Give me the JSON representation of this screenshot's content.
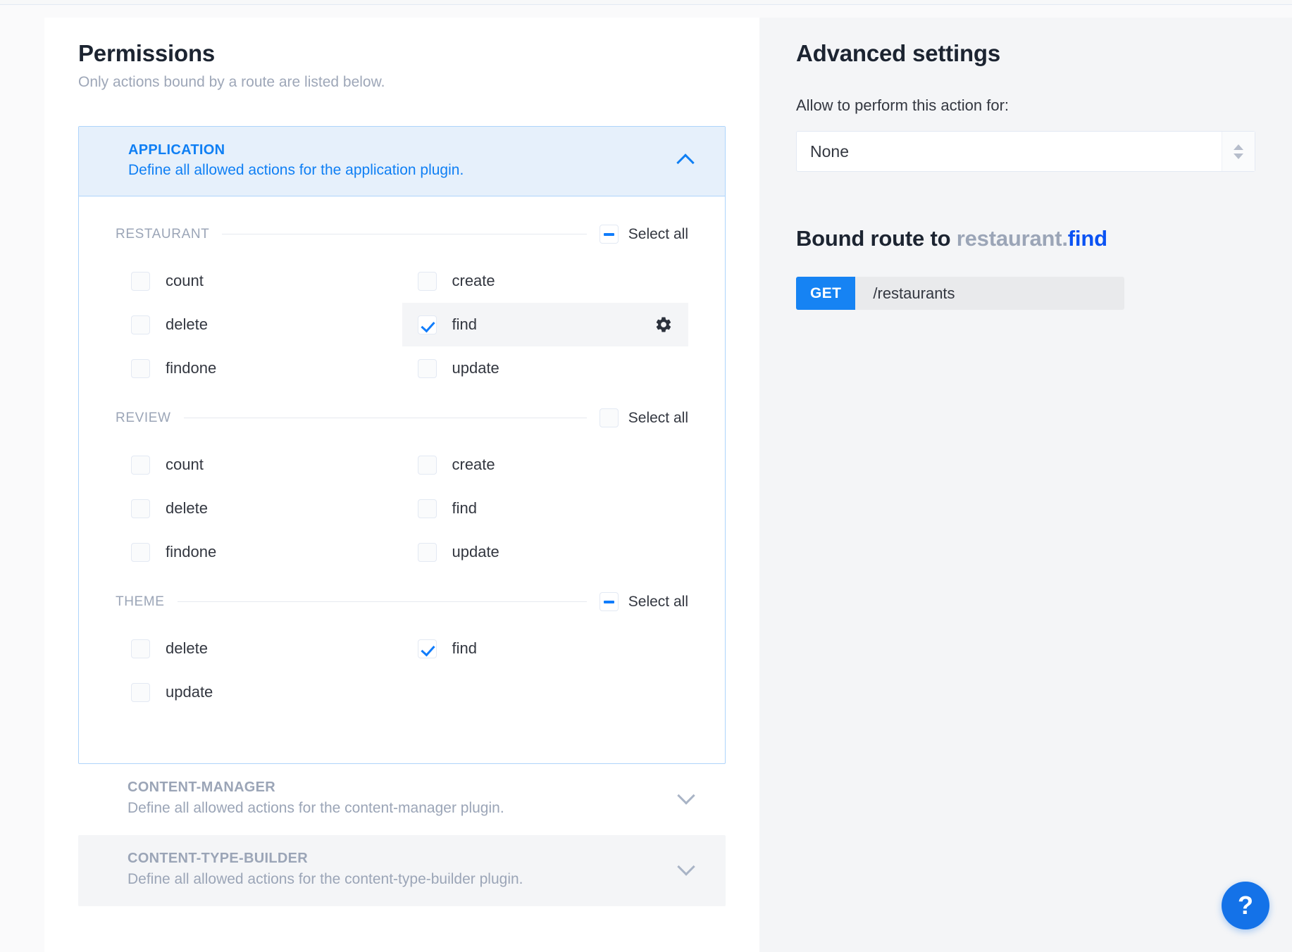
{
  "permissions": {
    "title": "Permissions",
    "subtitle": "Only actions bound by a route are listed below.",
    "accordions": [
      {
        "name": "APPLICATION",
        "description": "Define all allowed actions for the application plugin.",
        "expanded": true,
        "chevron_icon": "chevron-up-icon"
      },
      {
        "name": "CONTENT-MANAGER",
        "description": "Define all allowed actions for the content-manager plugin.",
        "expanded": false,
        "chevron_icon": "chevron-down-icon"
      },
      {
        "name": "CONTENT-TYPE-BUILDER",
        "description": "Define all allowed actions for the content-type-builder plugin.",
        "expanded": false,
        "chevron_icon": "chevron-down-icon"
      }
    ],
    "select_all_label": "Select all",
    "groups": [
      {
        "name": "RESTAURANT",
        "select_all_state": "indeterminate",
        "actions": [
          {
            "label": "count",
            "checked": false,
            "active": false
          },
          {
            "label": "create",
            "checked": false,
            "active": false
          },
          {
            "label": "delete",
            "checked": false,
            "active": false
          },
          {
            "label": "find",
            "checked": true,
            "active": true,
            "gear_icon": "gear-icon"
          },
          {
            "label": "findone",
            "checked": false,
            "active": false
          },
          {
            "label": "update",
            "checked": false,
            "active": false
          }
        ]
      },
      {
        "name": "REVIEW",
        "select_all_state": "unchecked",
        "actions": [
          {
            "label": "count",
            "checked": false,
            "active": false
          },
          {
            "label": "create",
            "checked": false,
            "active": false
          },
          {
            "label": "delete",
            "checked": false,
            "active": false
          },
          {
            "label": "find",
            "checked": false,
            "active": false
          },
          {
            "label": "findone",
            "checked": false,
            "active": false
          },
          {
            "label": "update",
            "checked": false,
            "active": false
          }
        ]
      },
      {
        "name": "THEME",
        "select_all_state": "indeterminate",
        "actions": [
          {
            "label": "delete",
            "checked": false,
            "active": false
          },
          {
            "label": "find",
            "checked": true,
            "active": false
          },
          {
            "label": "update",
            "checked": false,
            "active": false
          }
        ]
      }
    ]
  },
  "advanced": {
    "title": "Advanced settings",
    "allow_label": "Allow to perform this action for:",
    "policy_select": {
      "value": "None",
      "arrows_icon": "stepper-arrows-icon"
    },
    "bound_route": {
      "prefix": "Bound route to",
      "model": "restaurant",
      "separator": ".",
      "action": "find",
      "method": "GET",
      "path": "/restaurants"
    }
  },
  "help": {
    "label": "?",
    "icon": "question-mark-icon"
  },
  "colors": {
    "accent": "#0f7ff4",
    "accent_strong": "#107cfb",
    "link": "#0a52f3",
    "muted": "#9ba5b7",
    "panel_bg": "#f4f5f7",
    "accordion_open_bg": "#e6f0fb",
    "method_badge": "#1683f3"
  }
}
